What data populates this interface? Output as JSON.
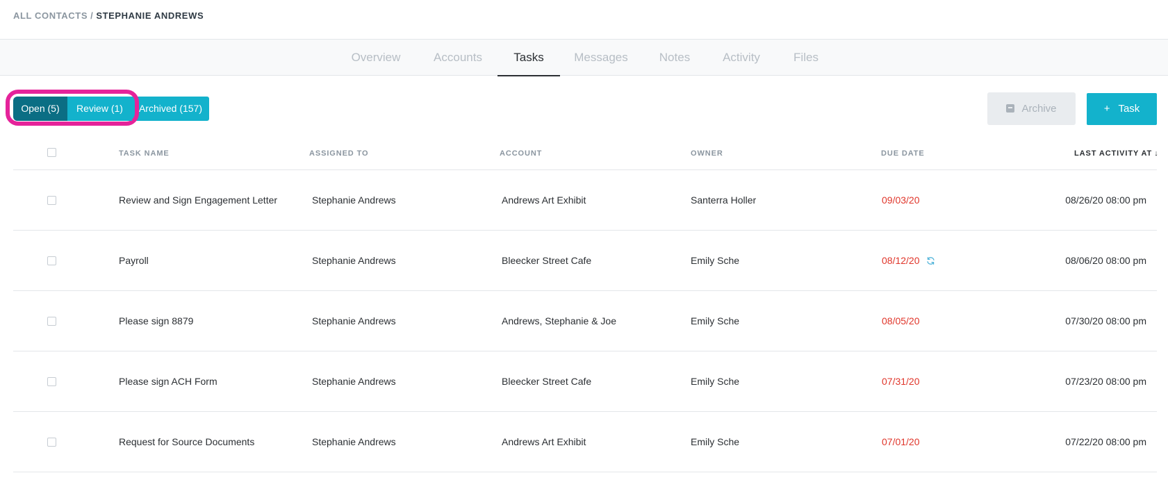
{
  "breadcrumb": {
    "parent": "ALL CONTACTS",
    "separator": "/",
    "current": "STEPHANIE ANDREWS"
  },
  "tabs": [
    {
      "label": "Overview",
      "active": false
    },
    {
      "label": "Accounts",
      "active": false
    },
    {
      "label": "Tasks",
      "active": true
    },
    {
      "label": "Messages",
      "active": false
    },
    {
      "label": "Notes",
      "active": false
    },
    {
      "label": "Activity",
      "active": false
    },
    {
      "label": "Files",
      "active": false
    }
  ],
  "filters": {
    "open": "Open (5)",
    "review": "Review (1)",
    "archived": "Archived (157)",
    "selected": "open"
  },
  "toolbar": {
    "archive_label": "Archive",
    "archive_icon": "archive-box-icon",
    "archive_enabled": false,
    "task_plus": "+",
    "task_label": "Task"
  },
  "table": {
    "columns": {
      "task_name": "TASK NAME",
      "assigned_to": "ASSIGNED TO",
      "account": "ACCOUNT",
      "owner": "OWNER",
      "due_date": "DUE DATE",
      "last_activity": "LAST ACTIVITY AT"
    },
    "sort_indicator": "↓",
    "rows": [
      {
        "task": "Review and Sign Engagement Letter",
        "assigned": "Stephanie Andrews",
        "account": "Andrews Art Exhibit",
        "owner": "Santerra Holler",
        "due": "09/03/20",
        "activity": "08/26/20 08:00 pm",
        "recurring": false
      },
      {
        "task": "Payroll",
        "assigned": "Stephanie Andrews",
        "account": "Bleecker Street Cafe",
        "owner": "Emily Sche",
        "due": "08/12/20",
        "activity": "08/06/20 08:00 pm",
        "recurring": true
      },
      {
        "task": "Please sign 8879",
        "assigned": "Stephanie Andrews",
        "account": "Andrews, Stephanie & Joe",
        "owner": "Emily Sche",
        "due": "08/05/20",
        "activity": "07/30/20 08:00 pm",
        "recurring": false
      },
      {
        "task": "Please sign ACH Form",
        "assigned": "Stephanie Andrews",
        "account": "Bleecker Street Cafe",
        "owner": "Emily Sche",
        "due": "07/31/20",
        "activity": "07/23/20 08:00 pm",
        "recurring": false
      },
      {
        "task": "Request for Source Documents",
        "assigned": "Stephanie Andrews",
        "account": "Andrews Art Exhibit",
        "owner": "Emily Sche",
        "due": "07/01/20",
        "activity": "07/22/20 08:00 pm",
        "recurring": false
      }
    ]
  },
  "colors": {
    "accent": "#13b2cc",
    "selected_filter": "#0b6e84",
    "highlight_outline": "#e5239a",
    "overdue": "#e0362b"
  }
}
